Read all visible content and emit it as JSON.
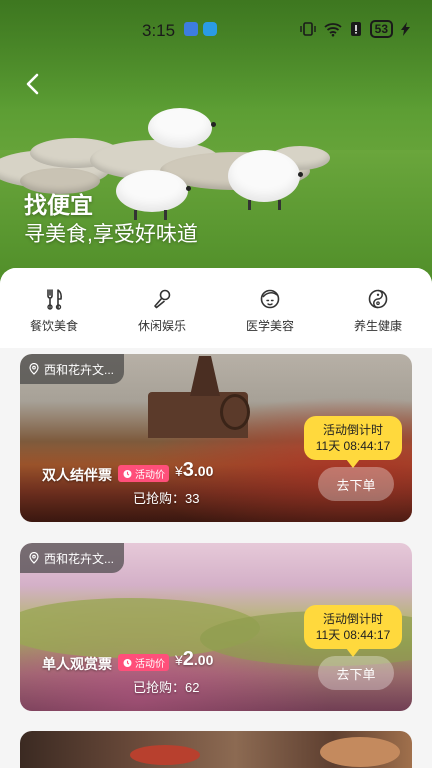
{
  "status_bar": {
    "time": "3:15",
    "battery": "53"
  },
  "hero": {
    "title": "找便宜",
    "subtitle": "寻美食,享受好味道"
  },
  "categories": [
    {
      "label": "餐饮美食",
      "icon": "utensils-icon"
    },
    {
      "label": "休闲娱乐",
      "icon": "microphone-icon"
    },
    {
      "label": "医学美容",
      "icon": "face-icon"
    },
    {
      "label": "养生健康",
      "icon": "yin-yang-icon"
    }
  ],
  "cards": [
    {
      "location": "西和花卉文...",
      "title": "双人结伴票",
      "promo": "活动价",
      "price_symbol": "¥",
      "price_int": "3",
      "price_dec": ".00",
      "sold": "已抢购：33",
      "countdown_label": "活动倒计时",
      "countdown_time": "11天 08:44:17",
      "order": "去下单"
    },
    {
      "location": "西和花卉文...",
      "title": "单人观赏票",
      "promo": "活动价",
      "price_symbol": "¥",
      "price_int": "2",
      "price_dec": ".00",
      "sold": "已抢购：62",
      "countdown_label": "活动倒计时",
      "countdown_time": "11天 08:44:17",
      "order": "去下单"
    }
  ],
  "colors": {
    "promo": "#ff4f7a",
    "countdown": "#ffd93d"
  }
}
